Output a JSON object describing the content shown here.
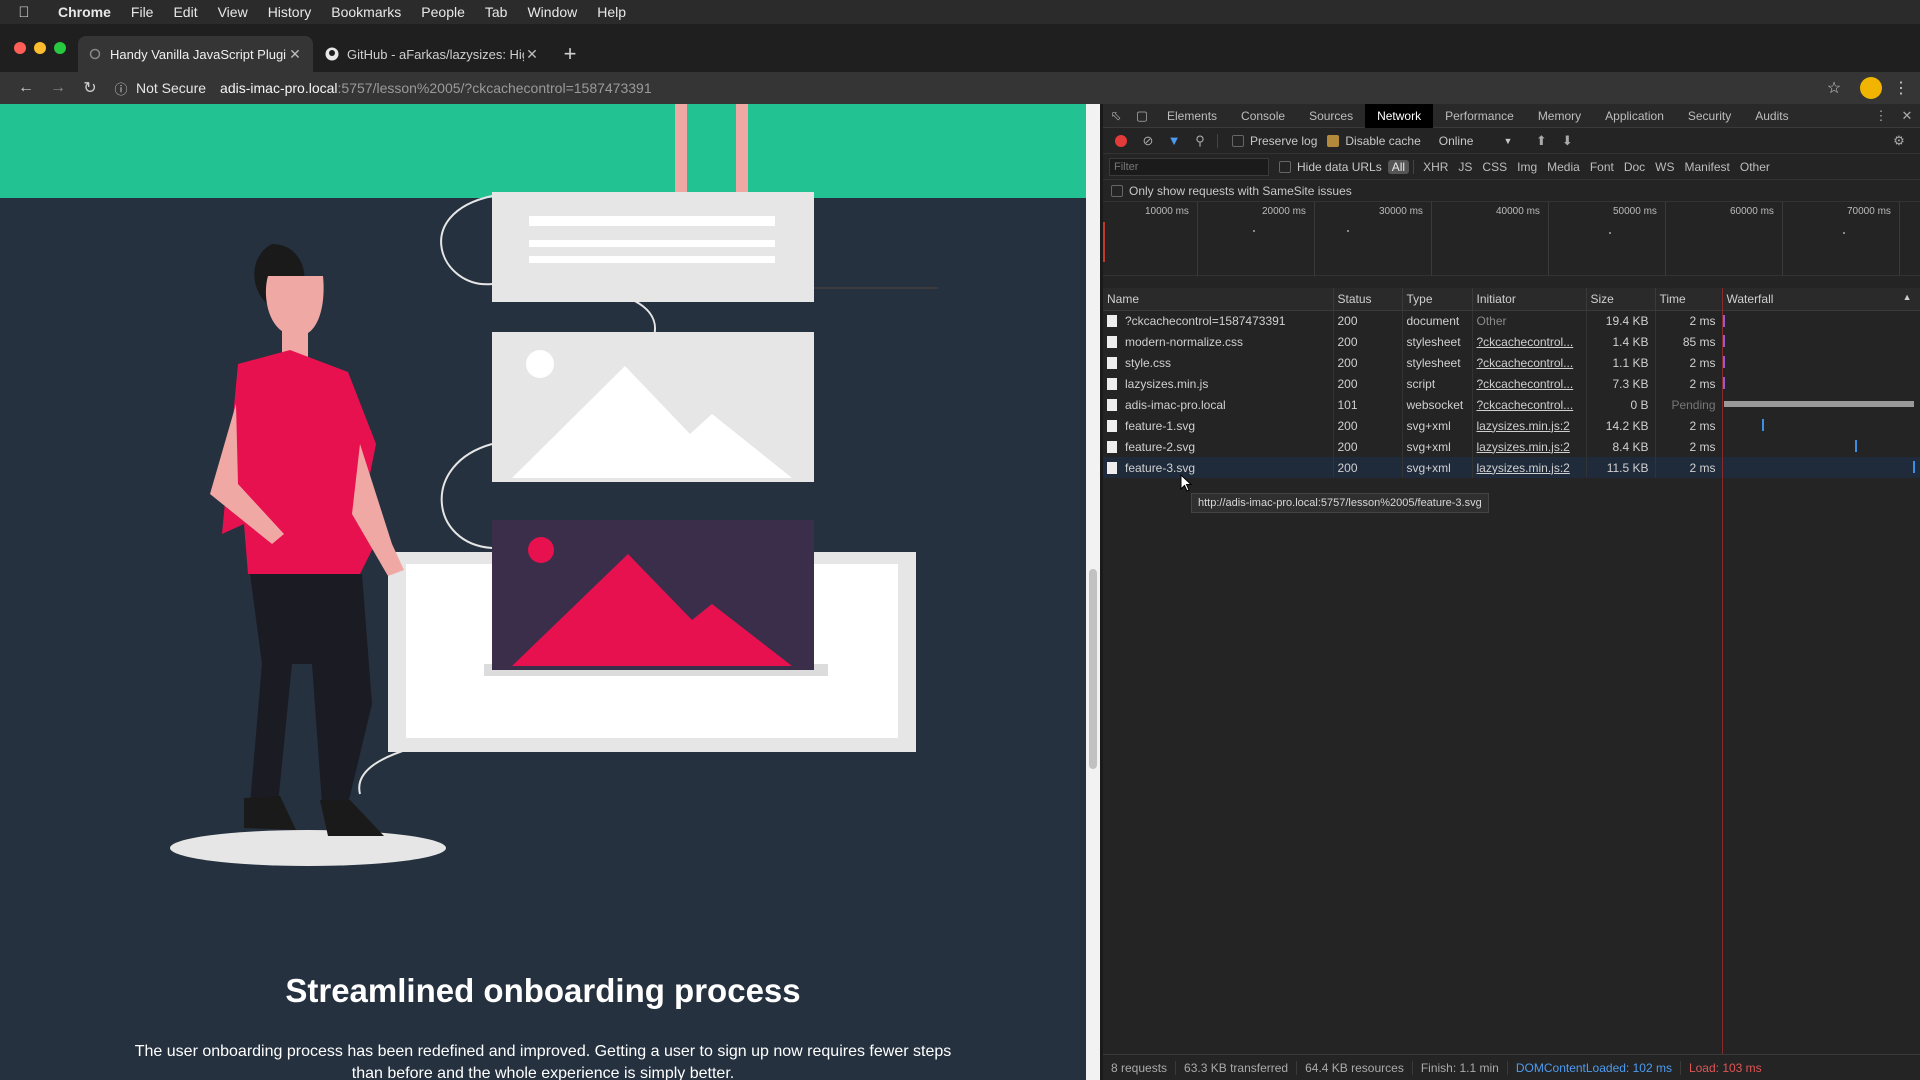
{
  "menubar": {
    "apple_icon": "apple-icon",
    "app_name": "Chrome",
    "items": [
      "File",
      "Edit",
      "View",
      "History",
      "Bookmarks",
      "People",
      "Tab",
      "Window",
      "Help"
    ]
  },
  "tabs": [
    {
      "title": "Handy Vanilla JavaScript Plugins",
      "active": true
    },
    {
      "title": "GitHub - aFarkas/lazysizes: High",
      "active": false
    }
  ],
  "toolbar": {
    "not_secure": "Not Secure",
    "url_host": "adis-imac-pro.local",
    "url_path": ":5757/lesson%2005/?ckcachecontrol=1587473391"
  },
  "page": {
    "heading": "Streamlined onboarding process",
    "paragraph": "The user onboarding process has been redefined and improved. Getting a user to sign up now requires fewer steps than before and the whole experience is simply better.",
    "colors": {
      "band": "#22c293",
      "background": "#25313f",
      "accent": "#e8114f"
    }
  },
  "devtools": {
    "tabs": [
      "Elements",
      "Console",
      "Sources",
      "Network",
      "Performance",
      "Memory",
      "Application",
      "Security",
      "Audits"
    ],
    "active_tab": "Network",
    "preserve_log": "Preserve log",
    "disable_cache": "Disable cache",
    "throttling": "Online",
    "filter_placeholder": "Filter",
    "hide_data_urls": "Hide data URLs",
    "filter_types": [
      "All",
      "XHR",
      "JS",
      "CSS",
      "Img",
      "Media",
      "Font",
      "Doc",
      "WS",
      "Manifest",
      "Other"
    ],
    "samesite": "Only show requests with SameSite issues",
    "overview_labels": [
      "10000 ms",
      "20000 ms",
      "30000 ms",
      "40000 ms",
      "50000 ms",
      "60000 ms",
      "70000 ms"
    ],
    "columns": [
      "Name",
      "Status",
      "Type",
      "Initiator",
      "Size",
      "Time",
      "Waterfall"
    ],
    "requests": [
      {
        "name": "?ckcachecontrol=1587473391",
        "status": "200",
        "type": "document",
        "initiator": "Other",
        "initiator_link": false,
        "size": "19.4 KB",
        "time": "2 ms",
        "wf_start": 0.002,
        "wf_end": 0.006,
        "wf_color": "#9b59d0"
      },
      {
        "name": "modern-normalize.css",
        "status": "200",
        "type": "stylesheet",
        "initiator": "?ckcachecontrol...",
        "initiator_link": true,
        "size": "1.4 KB",
        "time": "85 ms",
        "wf_start": 0.002,
        "wf_end": 0.006,
        "wf_color": "#9b59d0"
      },
      {
        "name": "style.css",
        "status": "200",
        "type": "stylesheet",
        "initiator": "?ckcachecontrol...",
        "initiator_link": true,
        "size": "1.1 KB",
        "time": "2 ms",
        "wf_start": 0.002,
        "wf_end": 0.006,
        "wf_color": "#9b59d0"
      },
      {
        "name": "lazysizes.min.js",
        "status": "200",
        "type": "script",
        "initiator": "?ckcachecontrol...",
        "initiator_link": true,
        "size": "7.3 KB",
        "time": "2 ms",
        "wf_start": 0.002,
        "wf_end": 0.006,
        "wf_color": "#9b59d0"
      },
      {
        "name": "adis-imac-pro.local",
        "status": "101",
        "type": "websocket",
        "initiator": "?ckcachecontrol...",
        "initiator_link": true,
        "size": "0 B",
        "time": "Pending",
        "wf_start": 0.01,
        "wf_end": 1.0,
        "wf_color": "#9a9a9a"
      },
      {
        "name": "feature-1.svg",
        "status": "200",
        "type": "svg+xml",
        "initiator": "lazysizes.min.js:2",
        "initiator_link": true,
        "size": "14.2 KB",
        "time": "2 ms",
        "wf_start": 0.205,
        "wf_end": 0.215,
        "wf_color": "#3a8ee6"
      },
      {
        "name": "feature-2.svg",
        "status": "200",
        "type": "svg+xml",
        "initiator": "lazysizes.min.js:2",
        "initiator_link": true,
        "size": "8.4 KB",
        "time": "2 ms",
        "wf_start": 0.69,
        "wf_end": 0.7,
        "wf_color": "#3a8ee6"
      },
      {
        "name": "feature-3.svg",
        "status": "200",
        "type": "svg+xml",
        "initiator": "lazysizes.min.js:2",
        "initiator_link": true,
        "size": "11.5 KB",
        "time": "2 ms",
        "wf_start": 0.99,
        "wf_end": 1.0,
        "wf_color": "#3a8ee6"
      }
    ],
    "tooltip": "http://adis-imac-pro.local:5757/lesson%2005/feature-3.svg",
    "status": {
      "requests": "8 requests",
      "transferred": "63.3 KB transferred",
      "resources": "64.4 KB resources",
      "finish": "Finish: 1.1 min",
      "dom_loaded": "DOMContentLoaded: 102 ms",
      "load": "Load: 103 ms"
    }
  }
}
